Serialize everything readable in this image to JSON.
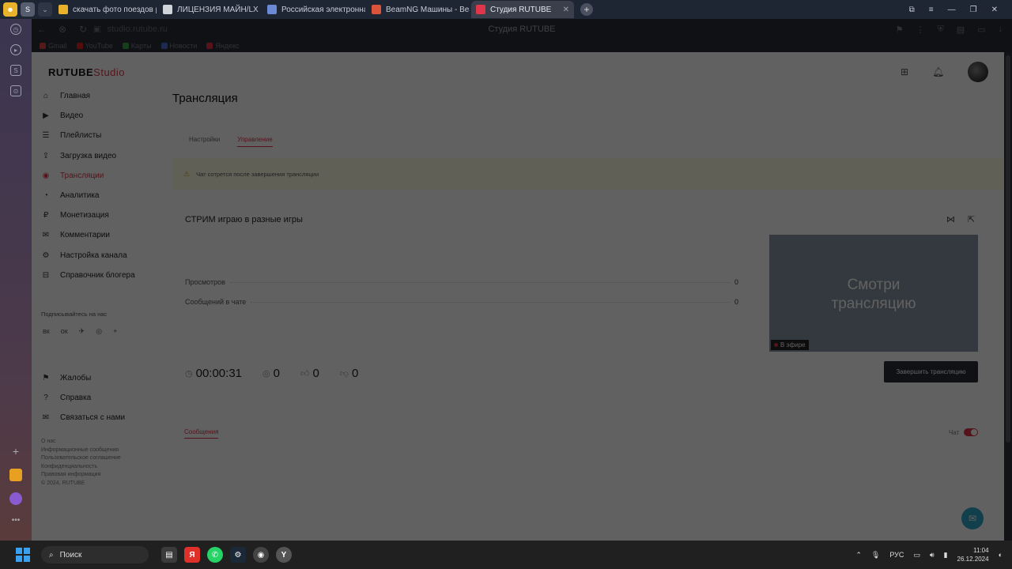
{
  "browser": {
    "tabs": [
      {
        "title": "скачать фото поездов рж",
        "color": "#e8b32a"
      },
      {
        "title": "ЛИЦЕНЗИЯ МАЙН/LX S",
        "color": "#cfd3da"
      },
      {
        "title": "Российская электронна",
        "color": "#6b8ad6"
      },
      {
        "title": "BeamNG Машины - Beam",
        "color": "#d9543a"
      },
      {
        "title": "Студия RUTUBE",
        "color": "#e0364b",
        "active": true
      }
    ],
    "url": "studio.rutube.ru",
    "page_title": "Студия RUTUBE",
    "bookmarks": [
      {
        "label": "Gmail",
        "color": "#d44"
      },
      {
        "label": "YouTube",
        "color": "#e02020"
      },
      {
        "label": "Карты",
        "color": "#3aa04a"
      },
      {
        "label": "Новости",
        "color": "#4a6fd1"
      },
      {
        "label": "Яндекс",
        "color": "#e0364b"
      }
    ]
  },
  "studio": {
    "logo": "RUTUBE",
    "logo_suffix": "Studio",
    "nav": [
      {
        "label": "Главная",
        "icon": "home-icon",
        "glyph": "⌂"
      },
      {
        "label": "Видео",
        "icon": "video-icon",
        "glyph": "▶"
      },
      {
        "label": "Плейлисты",
        "icon": "playlist-icon",
        "glyph": "☰"
      },
      {
        "label": "Загрузка видео",
        "icon": "upload-icon",
        "glyph": "⇪"
      },
      {
        "label": "Трансляции",
        "icon": "broadcast-icon",
        "glyph": "◉",
        "active": true
      },
      {
        "label": "Аналитика",
        "icon": "analytics-icon",
        "glyph": "◔"
      },
      {
        "label": "Монетизация",
        "icon": "money-icon",
        "glyph": "₽"
      },
      {
        "label": "Комментарии",
        "icon": "comments-icon",
        "glyph": "✉"
      },
      {
        "label": "Настройка канала",
        "icon": "gear-icon",
        "glyph": "⚙"
      },
      {
        "label": "Справочник блогера",
        "icon": "book-icon",
        "glyph": "⊟"
      }
    ],
    "subscribe_label": "Подписывайтесь на нас",
    "socials": [
      "вк",
      "ок",
      "✈",
      "◎",
      "+"
    ],
    "nav_bottom": [
      {
        "label": "Жалобы",
        "icon": "flag-icon",
        "glyph": "⚑"
      },
      {
        "label": "Справка",
        "icon": "help-icon",
        "glyph": "?"
      },
      {
        "label": "Связаться с нами",
        "icon": "mail-icon",
        "glyph": "✉"
      }
    ],
    "footer_links": [
      "О нас",
      "Информационные сообщения",
      "Пользовательское соглашение",
      "Конфиденциальность",
      "Правовая информация",
      "© 2024, RUTUBE"
    ],
    "heading": "Трансляция",
    "tabs": [
      {
        "label": "Настройки"
      },
      {
        "label": "Управление",
        "active": true
      }
    ],
    "notice": "Чат сотрется после завершения трансляции",
    "stream_name": "СТРИМ играю в разные игры",
    "stats": [
      {
        "label": "Просмотров",
        "value": "0"
      },
      {
        "label": "Сообщений в чате",
        "value": "0"
      }
    ],
    "counters": {
      "time": "00:00:31",
      "viewers": "0",
      "likes": "0",
      "dislikes": "0"
    },
    "preview_text_line1": "Смотри",
    "preview_text_line2": "трансляцию",
    "live_label": "В эфире",
    "end_button": "Завершить трансляцию",
    "messages_tab": "Сообщения",
    "chat_label": "Чат",
    "chat_enabled": true
  },
  "taskbar": {
    "search_placeholder": "Поиск",
    "language": "РУС",
    "time": "11:04",
    "date": "26.12.2024"
  }
}
